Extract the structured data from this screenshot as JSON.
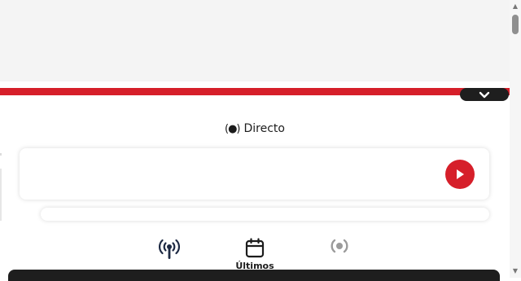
{
  "header": {
    "live_label": "Directo"
  },
  "nav": {
    "items": [
      {
        "icon": "antenna-icon",
        "label": ""
      },
      {
        "icon": "calendar-icon",
        "label": "Últimos"
      },
      {
        "icon": "radio-broadcast-icon",
        "label": ""
      }
    ]
  },
  "colors": {
    "accent": "#d61f2a",
    "dark": "#1e1e1e",
    "inactive_icon": "#9b9b9b"
  }
}
